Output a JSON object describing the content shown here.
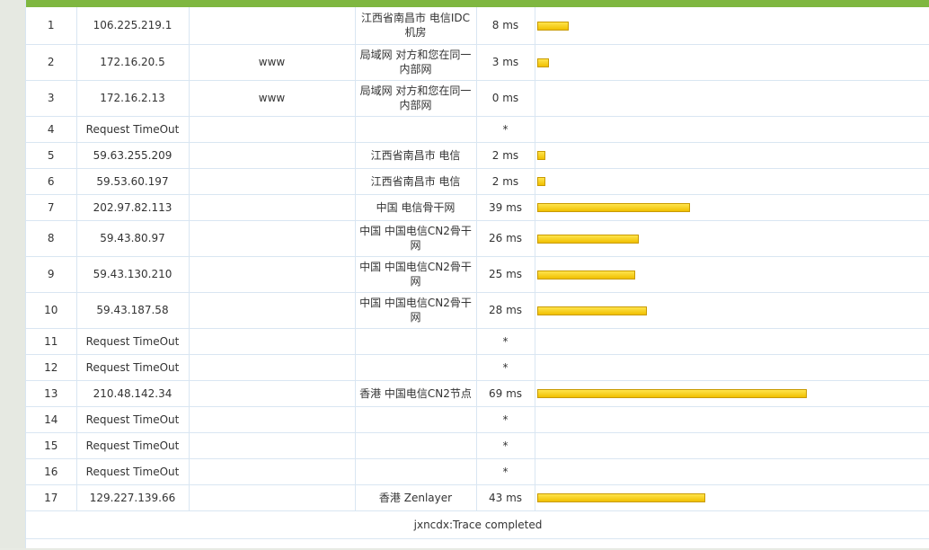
{
  "rows": [
    {
      "hop": "1",
      "ip": "106.225.219.1",
      "host": "",
      "loc": "江西省南昌市 电信IDC机房",
      "time": "8 ms",
      "ms": 8,
      "h": 41
    },
    {
      "hop": "2",
      "ip": "172.16.20.5",
      "host": "www",
      "loc": "局域网 对方和您在同一内部网",
      "time": "3 ms",
      "ms": 3,
      "h": 40
    },
    {
      "hop": "3",
      "ip": "172.16.2.13",
      "host": "www",
      "loc": "局域网 对方和您在同一内部网",
      "time": "0 ms",
      "ms": 0,
      "h": 40
    },
    {
      "hop": "4",
      "ip": "Request TimeOut",
      "host": "",
      "loc": "",
      "time": "*",
      "ms": null,
      "h": 29
    },
    {
      "hop": "5",
      "ip": "59.63.255.209",
      "host": "",
      "loc": "江西省南昌市 电信",
      "time": "2 ms",
      "ms": 2,
      "h": 29
    },
    {
      "hop": "6",
      "ip": "59.53.60.197",
      "host": "",
      "loc": "江西省南昌市 电信",
      "time": "2 ms",
      "ms": 2,
      "h": 29
    },
    {
      "hop": "7",
      "ip": "202.97.82.113",
      "host": "",
      "loc": "中国 电信骨干网",
      "time": "39 ms",
      "ms": 39,
      "h": 29
    },
    {
      "hop": "8",
      "ip": "59.43.80.97",
      "host": "",
      "loc": "中国 中国电信CN2骨干网",
      "time": "26 ms",
      "ms": 26,
      "h": 40
    },
    {
      "hop": "9",
      "ip": "59.43.130.210",
      "host": "",
      "loc": "中国 中国电信CN2骨干网",
      "time": "25 ms",
      "ms": 25,
      "h": 40
    },
    {
      "hop": "10",
      "ip": "59.43.187.58",
      "host": "",
      "loc": "中国 中国电信CN2骨干网",
      "time": "28 ms",
      "ms": 28,
      "h": 40
    },
    {
      "hop": "11",
      "ip": "Request TimeOut",
      "host": "",
      "loc": "",
      "time": "*",
      "ms": null,
      "h": 29
    },
    {
      "hop": "12",
      "ip": "Request TimeOut",
      "host": "",
      "loc": "",
      "time": "*",
      "ms": null,
      "h": 29
    },
    {
      "hop": "13",
      "ip": "210.48.142.34",
      "host": "",
      "loc": "香港 中国电信CN2节点",
      "time": "69 ms",
      "ms": 69,
      "h": 29
    },
    {
      "hop": "14",
      "ip": "Request TimeOut",
      "host": "",
      "loc": "",
      "time": "*",
      "ms": null,
      "h": 29
    },
    {
      "hop": "15",
      "ip": "Request TimeOut",
      "host": "",
      "loc": "",
      "time": "*",
      "ms": null,
      "h": 29
    },
    {
      "hop": "16",
      "ip": "Request TimeOut",
      "host": "",
      "loc": "",
      "time": "*",
      "ms": null,
      "h": 29
    },
    {
      "hop": "17",
      "ip": "129.227.139.66",
      "host": "",
      "loc": "香港 Zenlayer",
      "time": "43 ms",
      "ms": 43,
      "h": 29
    }
  ],
  "footer": {
    "status": "jxncdx:Trace completed"
  },
  "colors": {
    "topbar": "#7fb740",
    "bar": "#f0c000",
    "grid": "#d9e6f2"
  }
}
